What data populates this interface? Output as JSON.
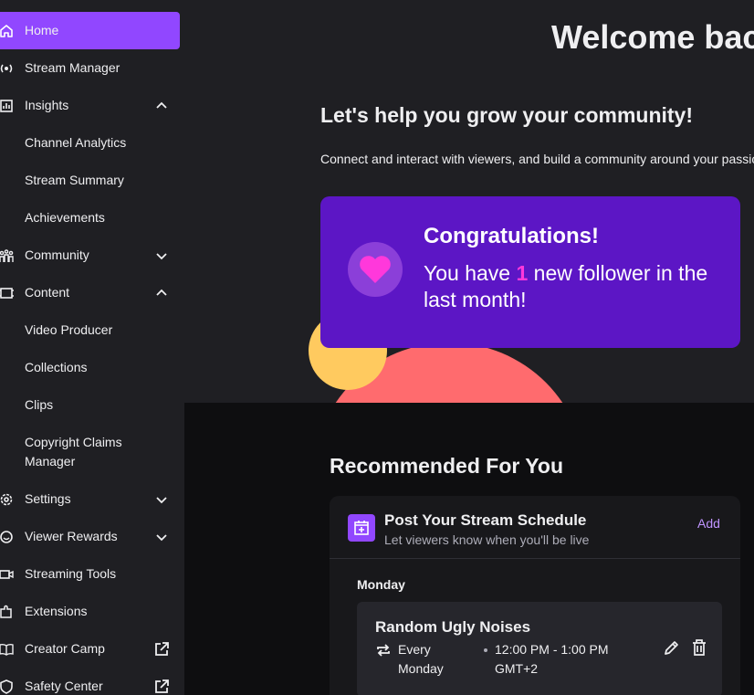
{
  "sidebar": {
    "items": [
      {
        "label": "Home",
        "icon": "home-icon"
      },
      {
        "label": "Stream Manager",
        "icon": "broadcast-icon"
      },
      {
        "label": "Insights",
        "icon": "chart-icon",
        "expanded": true
      },
      {
        "label": "Channel Analytics"
      },
      {
        "label": "Stream Summary"
      },
      {
        "label": "Achievements"
      },
      {
        "label": "Community",
        "icon": "community-icon",
        "expanded": false
      },
      {
        "label": "Content",
        "icon": "content-icon",
        "expanded": true
      },
      {
        "label": "Video Producer"
      },
      {
        "label": "Collections"
      },
      {
        "label": "Clips"
      },
      {
        "label": "Copyright Claims Manager"
      },
      {
        "label": "Settings",
        "icon": "gear-icon",
        "expanded": false
      },
      {
        "label": "Viewer Rewards",
        "icon": "smile-icon",
        "expanded": false
      },
      {
        "label": "Streaming Tools",
        "icon": "camera-icon"
      },
      {
        "label": "Extensions",
        "icon": "puzzle-icon"
      },
      {
        "label": "Creator Camp",
        "icon": "book-icon"
      },
      {
        "label": "Safety Center",
        "icon": "shield-icon"
      }
    ]
  },
  "hero": {
    "welcome": "Welcome back",
    "grow_title": "Let's help you grow your community!",
    "grow_sub": "Connect and interact with viewers, and build a community around your passion."
  },
  "congrats": {
    "title": "Congratulations!",
    "body_before": "You have ",
    "count": "1",
    "body_after": " new follower in the last month!"
  },
  "recommended": {
    "title": "Recommended For You",
    "card": {
      "title": "Post Your Stream Schedule",
      "subtitle": "Let viewers know when you'll be live",
      "add_label": "Add",
      "day": "Monday",
      "schedule": {
        "title": "Random Ugly Noises",
        "repeat": "Every Monday",
        "time": "12:00 PM - 1:00 PM GMT+2"
      }
    }
  },
  "colors": {
    "accent": "#9147ff",
    "congrats_bg": "#5c16c5",
    "highlight": "#ff38db",
    "link": "#bf94ff"
  }
}
